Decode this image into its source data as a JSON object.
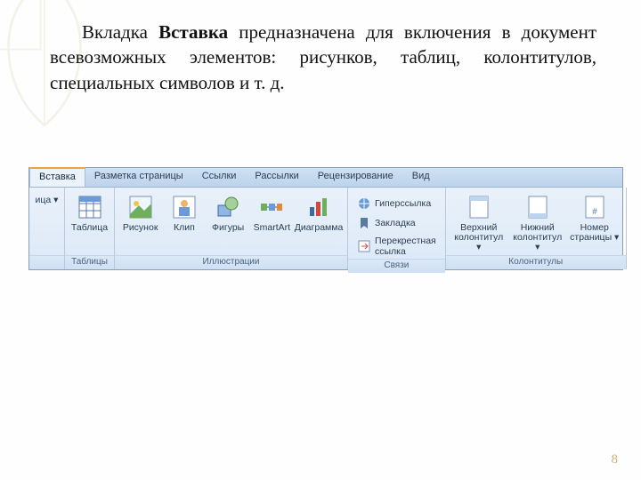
{
  "slide": {
    "text_prefix": "Вкладка ",
    "text_bold": "Вставка",
    "text_rest": " предназначена для включения в документ всевозможных элементов: рисунков, таблиц, колонтитулов, специальных символов и т. д.",
    "page_number": "8"
  },
  "ribbon": {
    "tabs": [
      {
        "label": "Вставка",
        "active": true
      },
      {
        "label": "Разметка страницы",
        "active": false
      },
      {
        "label": "Ссылки",
        "active": false
      },
      {
        "label": "Рассылки",
        "active": false
      },
      {
        "label": "Рецензирование",
        "active": false
      },
      {
        "label": "Вид",
        "active": false
      }
    ],
    "groups": {
      "pages_partial": {
        "btn": "ица ▾"
      },
      "tables": {
        "label": "Таблицы",
        "table_btn": "Таблица"
      },
      "illustrations": {
        "label": "Иллюстрации",
        "items": [
          "Рисунок",
          "Клип",
          "Фигуры",
          "SmartArt",
          "Диаграмма"
        ]
      },
      "links": {
        "label": "Связи",
        "items": [
          "Гиперссылка",
          "Закладка",
          "Перекрестная ссылка"
        ]
      },
      "headerfooter": {
        "label": "Колонтитулы",
        "items": [
          "Верхний колонтитул ▾",
          "Нижний колонтитул ▾",
          "Номер страницы ▾"
        ]
      }
    }
  }
}
